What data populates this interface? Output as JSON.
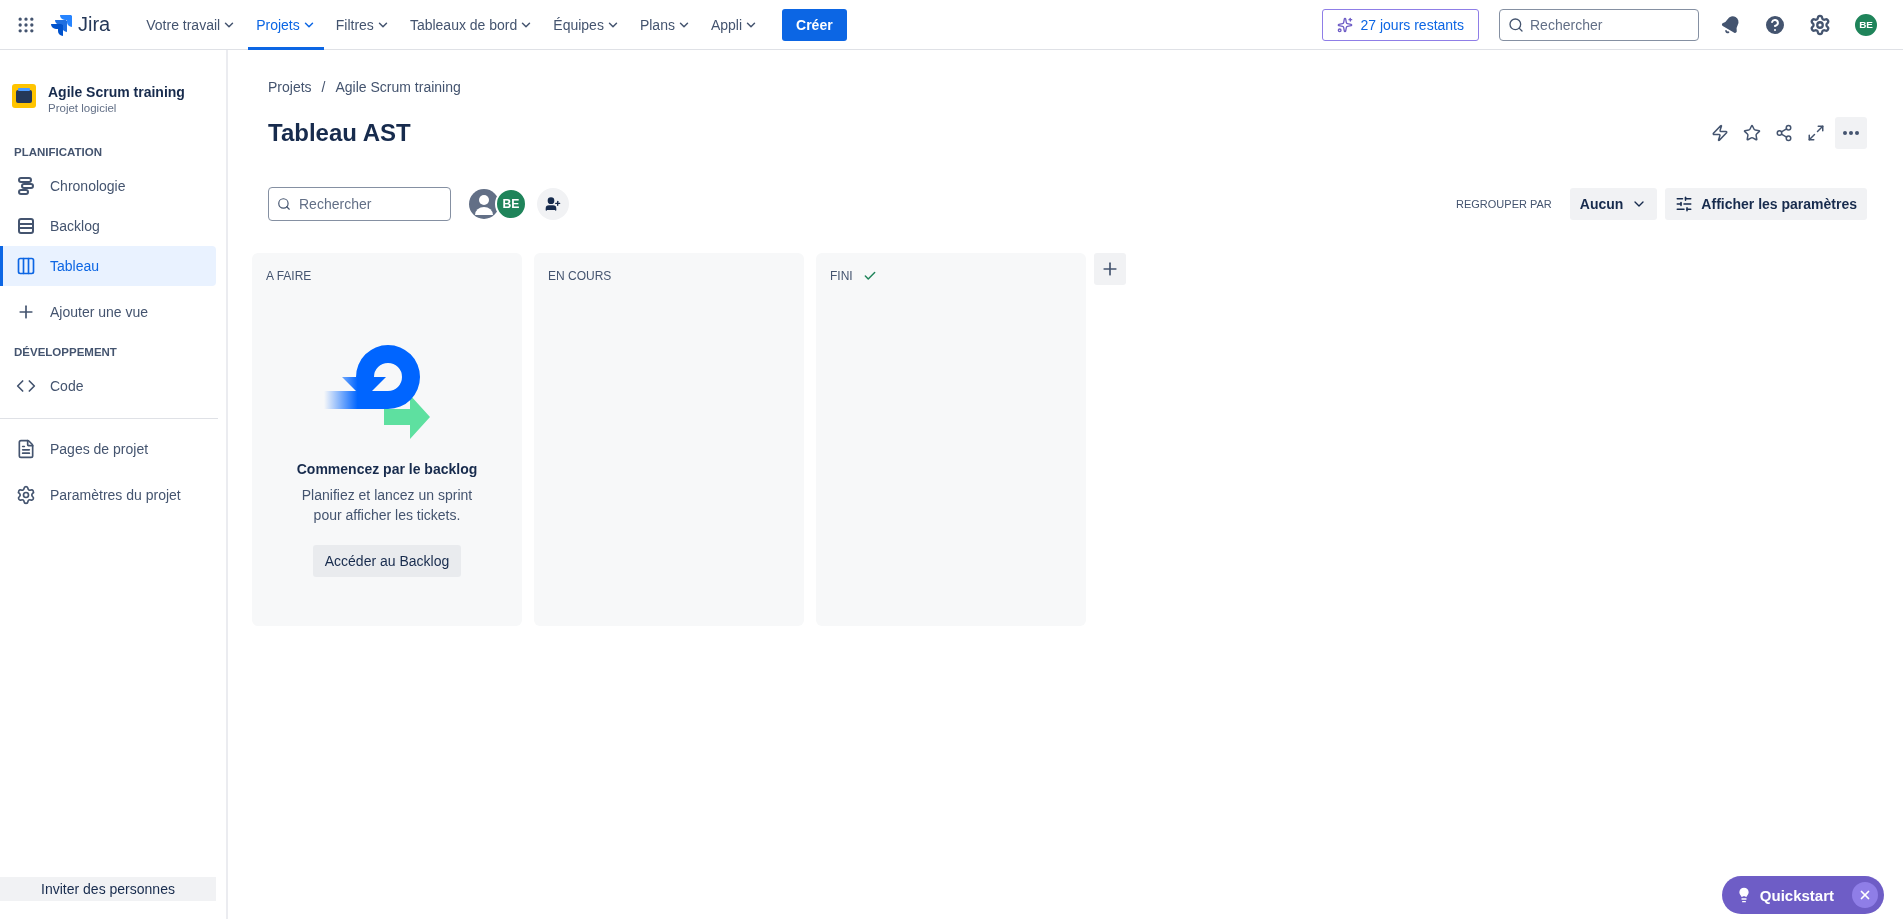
{
  "topbar": {
    "product": "Jira",
    "nav": [
      {
        "label": "Votre travail",
        "selected": false
      },
      {
        "label": "Projets",
        "selected": true
      },
      {
        "label": "Filtres",
        "selected": false
      },
      {
        "label": "Tableaux de bord",
        "selected": false
      },
      {
        "label": "Équipes",
        "selected": false
      },
      {
        "label": "Plans",
        "selected": false
      },
      {
        "label": "Appli",
        "selected": false
      }
    ],
    "create_button": "Créer",
    "trial": "27 jours restants",
    "search": {
      "placeholder": "Rechercher"
    },
    "avatar": "BE"
  },
  "sidebar": {
    "project": {
      "name": "Agile Scrum training",
      "type": "Projet logiciel"
    },
    "sections": [
      {
        "heading": "PLANIFICATION",
        "items": [
          {
            "label": "Chronologie",
            "kind": "timeline",
            "selected": false
          },
          {
            "label": "Backlog",
            "kind": "backlog",
            "selected": false
          },
          {
            "label": "Tableau",
            "kind": "board",
            "selected": true
          },
          {
            "label": "Ajouter une vue",
            "kind": "add",
            "selected": false
          }
        ]
      },
      {
        "heading": "DÉVELOPPEMENT",
        "items": [
          {
            "label": "Code",
            "kind": "code",
            "selected": false
          }
        ]
      }
    ],
    "footer_items": [
      {
        "label": "Pages de projet",
        "kind": "pages",
        "selected": false
      },
      {
        "label": "Paramètres du projet",
        "kind": "settings",
        "selected": false
      }
    ],
    "invite_button": "Inviter des personnes"
  },
  "breadcrumbs": [
    "Projets",
    "Agile Scrum training"
  ],
  "breadcrumb_separator": "/",
  "title": "Tableau AST",
  "board_search": {
    "placeholder": "Rechercher"
  },
  "assignee_avatar": "BE",
  "group_by": {
    "label": "REGROUPER PAR",
    "value": "Aucun"
  },
  "settings_button": "Afficher les paramètres",
  "columns": [
    {
      "title": "A FAIRE",
      "done": false,
      "empty_state": {
        "title": "Commencez par le backlog",
        "text": "Planifiez et lancez un sprint pour afficher les tickets.",
        "button": "Accéder au Backlog"
      }
    },
    {
      "title": "EN COURS",
      "done": false
    },
    {
      "title": "FINI",
      "done": true
    }
  ],
  "quickstart": "Quickstart"
}
